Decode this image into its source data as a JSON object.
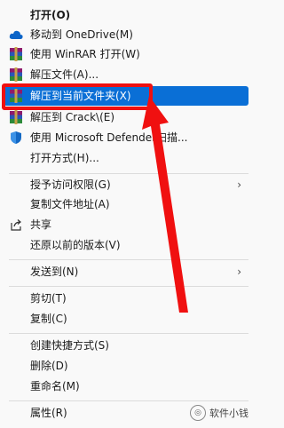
{
  "menu": {
    "items": [
      {
        "label": "打开(O)",
        "icon": "none"
      },
      {
        "label": "移动到 OneDrive(M)",
        "icon": "onedrive-icon"
      },
      {
        "label": "使用 WinRAR 打开(W)",
        "icon": "winrar-icon"
      },
      {
        "label": "解压文件(A)...",
        "icon": "winrar-icon"
      },
      {
        "label": "解压到当前文件夹(X)",
        "icon": "winrar-icon"
      },
      {
        "label": "解压到 Crack\\(E)",
        "icon": "winrar-icon"
      },
      {
        "label": "使用 Microsoft Defender扫描...",
        "icon": "defender-shield-icon"
      },
      {
        "label": "打开方式(H)...",
        "icon": "none"
      },
      {
        "label": "授予访问权限(G)",
        "icon": "none"
      },
      {
        "label": "复制文件地址(A)",
        "icon": "none"
      },
      {
        "label": "共享",
        "icon": "share-icon"
      },
      {
        "label": "还原以前的版本(V)",
        "icon": "none"
      },
      {
        "label": "发送到(N)",
        "icon": "none"
      },
      {
        "label": "剪切(T)",
        "icon": "none"
      },
      {
        "label": "复制(C)",
        "icon": "none"
      },
      {
        "label": "创建快捷方式(S)",
        "icon": "none"
      },
      {
        "label": "删除(D)",
        "icon": "none"
      },
      {
        "label": "重命名(M)",
        "icon": "none"
      },
      {
        "label": "属性(R)",
        "icon": "none"
      }
    ],
    "highlighted": "解压到当前文件夹(X)"
  },
  "watermark": {
    "text": "软件小钱"
  },
  "colors": {
    "highlight": "#0a6fd6",
    "annotation": "#f01010"
  }
}
